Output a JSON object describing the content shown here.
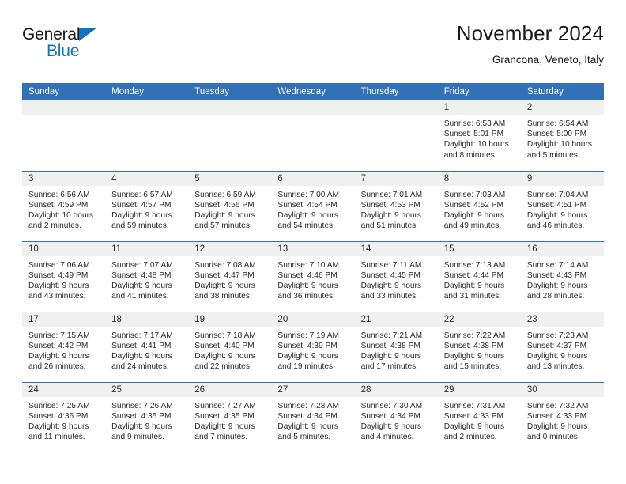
{
  "brand": {
    "name_top": "General",
    "name_bottom": "Blue",
    "triangle_color": "#1273bc"
  },
  "header": {
    "title": "November 2024",
    "subtitle": "Grancona, Veneto, Italy"
  },
  "colors": {
    "header_blue": "#3072b5",
    "daynum_band": "#f0f0f0",
    "text": "#2b2b2b"
  },
  "weekday_headers": [
    "Sunday",
    "Monday",
    "Tuesday",
    "Wednesday",
    "Thursday",
    "Friday",
    "Saturday"
  ],
  "labels": {
    "sunrise": "Sunrise:",
    "sunset": "Sunset:",
    "daylight": "Daylight:"
  },
  "weeks": [
    [
      {
        "day": "",
        "empty": true
      },
      {
        "day": "",
        "empty": true
      },
      {
        "day": "",
        "empty": true
      },
      {
        "day": "",
        "empty": true
      },
      {
        "day": "",
        "empty": true
      },
      {
        "day": "1",
        "sunrise": "Sunrise: 6:53 AM",
        "sunset": "Sunset: 5:01 PM",
        "daylight1": "Daylight: 10 hours",
        "daylight2": "and 8 minutes."
      },
      {
        "day": "2",
        "sunrise": "Sunrise: 6:54 AM",
        "sunset": "Sunset: 5:00 PM",
        "daylight1": "Daylight: 10 hours",
        "daylight2": "and 5 minutes."
      }
    ],
    [
      {
        "day": "3",
        "sunrise": "Sunrise: 6:56 AM",
        "sunset": "Sunset: 4:59 PM",
        "daylight1": "Daylight: 10 hours",
        "daylight2": "and 2 minutes."
      },
      {
        "day": "4",
        "sunrise": "Sunrise: 6:57 AM",
        "sunset": "Sunset: 4:57 PM",
        "daylight1": "Daylight: 9 hours",
        "daylight2": "and 59 minutes."
      },
      {
        "day": "5",
        "sunrise": "Sunrise: 6:59 AM",
        "sunset": "Sunset: 4:56 PM",
        "daylight1": "Daylight: 9 hours",
        "daylight2": "and 57 minutes."
      },
      {
        "day": "6",
        "sunrise": "Sunrise: 7:00 AM",
        "sunset": "Sunset: 4:54 PM",
        "daylight1": "Daylight: 9 hours",
        "daylight2": "and 54 minutes."
      },
      {
        "day": "7",
        "sunrise": "Sunrise: 7:01 AM",
        "sunset": "Sunset: 4:53 PM",
        "daylight1": "Daylight: 9 hours",
        "daylight2": "and 51 minutes."
      },
      {
        "day": "8",
        "sunrise": "Sunrise: 7:03 AM",
        "sunset": "Sunset: 4:52 PM",
        "daylight1": "Daylight: 9 hours",
        "daylight2": "and 49 minutes."
      },
      {
        "day": "9",
        "sunrise": "Sunrise: 7:04 AM",
        "sunset": "Sunset: 4:51 PM",
        "daylight1": "Daylight: 9 hours",
        "daylight2": "and 46 minutes."
      }
    ],
    [
      {
        "day": "10",
        "sunrise": "Sunrise: 7:06 AM",
        "sunset": "Sunset: 4:49 PM",
        "daylight1": "Daylight: 9 hours",
        "daylight2": "and 43 minutes."
      },
      {
        "day": "11",
        "sunrise": "Sunrise: 7:07 AM",
        "sunset": "Sunset: 4:48 PM",
        "daylight1": "Daylight: 9 hours",
        "daylight2": "and 41 minutes."
      },
      {
        "day": "12",
        "sunrise": "Sunrise: 7:08 AM",
        "sunset": "Sunset: 4:47 PM",
        "daylight1": "Daylight: 9 hours",
        "daylight2": "and 38 minutes."
      },
      {
        "day": "13",
        "sunrise": "Sunrise: 7:10 AM",
        "sunset": "Sunset: 4:46 PM",
        "daylight1": "Daylight: 9 hours",
        "daylight2": "and 36 minutes."
      },
      {
        "day": "14",
        "sunrise": "Sunrise: 7:11 AM",
        "sunset": "Sunset: 4:45 PM",
        "daylight1": "Daylight: 9 hours",
        "daylight2": "and 33 minutes."
      },
      {
        "day": "15",
        "sunrise": "Sunrise: 7:13 AM",
        "sunset": "Sunset: 4:44 PM",
        "daylight1": "Daylight: 9 hours",
        "daylight2": "and 31 minutes."
      },
      {
        "day": "16",
        "sunrise": "Sunrise: 7:14 AM",
        "sunset": "Sunset: 4:43 PM",
        "daylight1": "Daylight: 9 hours",
        "daylight2": "and 28 minutes."
      }
    ],
    [
      {
        "day": "17",
        "sunrise": "Sunrise: 7:15 AM",
        "sunset": "Sunset: 4:42 PM",
        "daylight1": "Daylight: 9 hours",
        "daylight2": "and 26 minutes."
      },
      {
        "day": "18",
        "sunrise": "Sunrise: 7:17 AM",
        "sunset": "Sunset: 4:41 PM",
        "daylight1": "Daylight: 9 hours",
        "daylight2": "and 24 minutes."
      },
      {
        "day": "19",
        "sunrise": "Sunrise: 7:18 AM",
        "sunset": "Sunset: 4:40 PM",
        "daylight1": "Daylight: 9 hours",
        "daylight2": "and 22 minutes."
      },
      {
        "day": "20",
        "sunrise": "Sunrise: 7:19 AM",
        "sunset": "Sunset: 4:39 PM",
        "daylight1": "Daylight: 9 hours",
        "daylight2": "and 19 minutes."
      },
      {
        "day": "21",
        "sunrise": "Sunrise: 7:21 AM",
        "sunset": "Sunset: 4:38 PM",
        "daylight1": "Daylight: 9 hours",
        "daylight2": "and 17 minutes."
      },
      {
        "day": "22",
        "sunrise": "Sunrise: 7:22 AM",
        "sunset": "Sunset: 4:38 PM",
        "daylight1": "Daylight: 9 hours",
        "daylight2": "and 15 minutes."
      },
      {
        "day": "23",
        "sunrise": "Sunrise: 7:23 AM",
        "sunset": "Sunset: 4:37 PM",
        "daylight1": "Daylight: 9 hours",
        "daylight2": "and 13 minutes."
      }
    ],
    [
      {
        "day": "24",
        "sunrise": "Sunrise: 7:25 AM",
        "sunset": "Sunset: 4:36 PM",
        "daylight1": "Daylight: 9 hours",
        "daylight2": "and 11 minutes."
      },
      {
        "day": "25",
        "sunrise": "Sunrise: 7:26 AM",
        "sunset": "Sunset: 4:35 PM",
        "daylight1": "Daylight: 9 hours",
        "daylight2": "and 9 minutes."
      },
      {
        "day": "26",
        "sunrise": "Sunrise: 7:27 AM",
        "sunset": "Sunset: 4:35 PM",
        "daylight1": "Daylight: 9 hours",
        "daylight2": "and 7 minutes."
      },
      {
        "day": "27",
        "sunrise": "Sunrise: 7:28 AM",
        "sunset": "Sunset: 4:34 PM",
        "daylight1": "Daylight: 9 hours",
        "daylight2": "and 5 minutes."
      },
      {
        "day": "28",
        "sunrise": "Sunrise: 7:30 AM",
        "sunset": "Sunset: 4:34 PM",
        "daylight1": "Daylight: 9 hours",
        "daylight2": "and 4 minutes."
      },
      {
        "day": "29",
        "sunrise": "Sunrise: 7:31 AM",
        "sunset": "Sunset: 4:33 PM",
        "daylight1": "Daylight: 9 hours",
        "daylight2": "and 2 minutes."
      },
      {
        "day": "30",
        "sunrise": "Sunrise: 7:32 AM",
        "sunset": "Sunset: 4:33 PM",
        "daylight1": "Daylight: 9 hours",
        "daylight2": "and 0 minutes."
      }
    ]
  ]
}
